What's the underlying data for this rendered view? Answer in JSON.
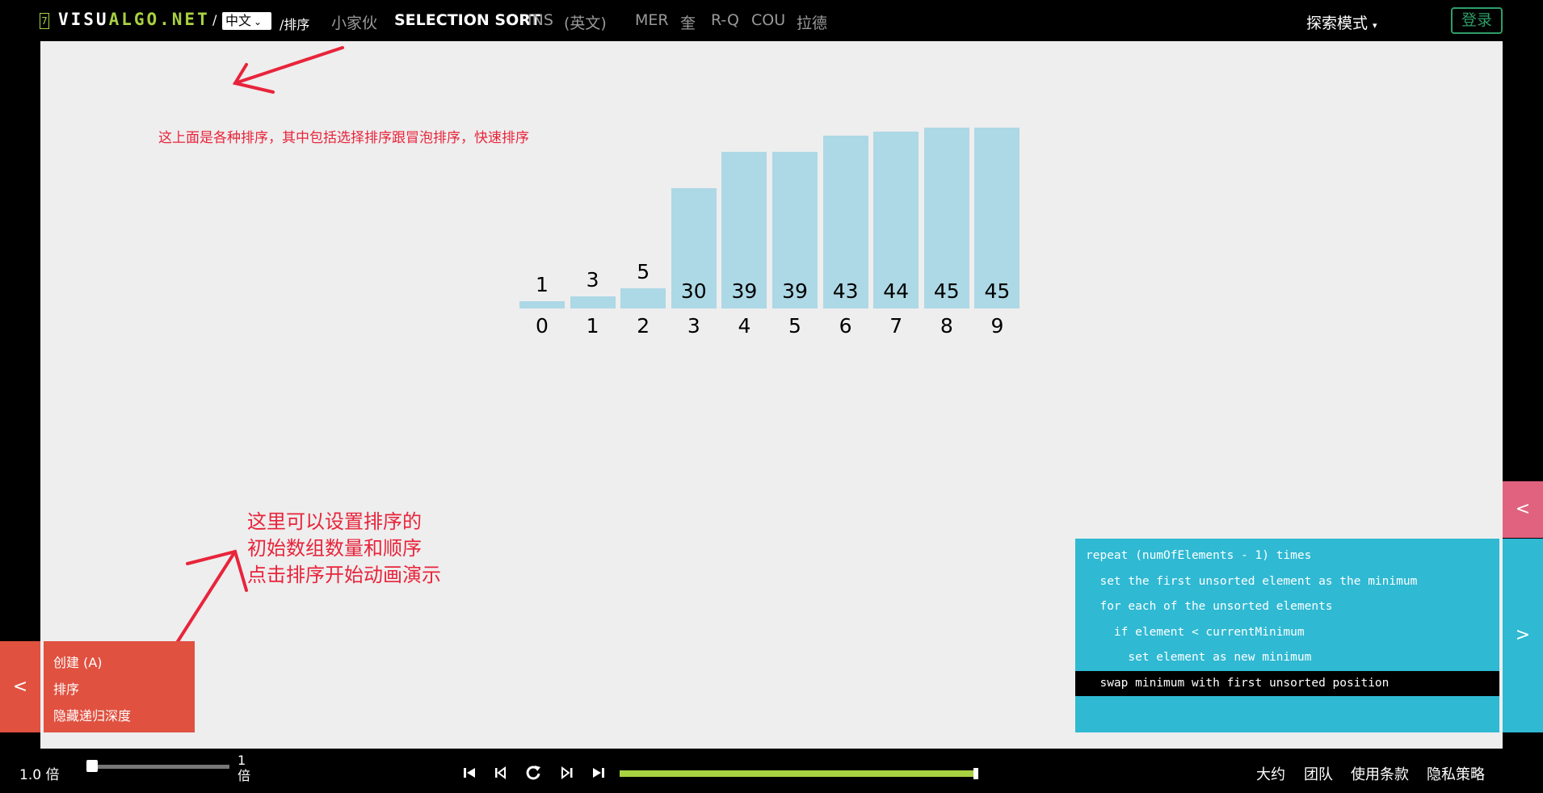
{
  "header": {
    "logo_badge": "7",
    "logo_white": "VISU",
    "logo_green": "ALGO.NET",
    "sep": "/",
    "lang_select": "中文",
    "breadcrumb": "/排序",
    "nav": [
      "小家伙",
      "SELECTION SORT",
      "INS",
      "(英文)",
      "MER",
      "奎",
      "R-Q",
      "COU",
      "拉德"
    ],
    "active_nav": "SELECTION SORT",
    "explore_mode": "探索模式",
    "login": "登录"
  },
  "annotations": {
    "top_note": "这上面是各种排序，其中包括选择排序跟冒泡排序，快速排序",
    "bottom_note": [
      "这里可以设置排序的",
      "初始数组数量和顺序",
      "点击排序开始动画演示"
    ],
    "color": "#e8243b"
  },
  "array": {
    "values": [
      1,
      3,
      5,
      30,
      39,
      39,
      43,
      44,
      45,
      45
    ],
    "indices": [
      0,
      1,
      2,
      3,
      4,
      5,
      6,
      7,
      8,
      9
    ],
    "bar_color": "#add8e6"
  },
  "actions": {
    "tab_icon": "<",
    "items": [
      "创建  (A)",
      "排序",
      "隐藏递归深度"
    ]
  },
  "code": {
    "lines": [
      "repeat (numOfElements - 1) times",
      "  set the first unsorted element as the minimum",
      "  for each of the unsorted elements",
      "    if element < currentMinimum",
      "      set element as new minimum",
      "  swap minimum with first unsorted position"
    ],
    "highlighted_line": 5,
    "panel_color": "#2fb9d3"
  },
  "side_tabs": {
    "collapse": "<",
    "expand": ">"
  },
  "playback": {
    "speed_label": "1.0 倍",
    "speed_value_top": "1",
    "speed_value_bottom": "倍",
    "progress_fraction": 1.0
  },
  "footer": [
    "大约",
    "团队",
    "使用条款",
    "隐私策略"
  ]
}
